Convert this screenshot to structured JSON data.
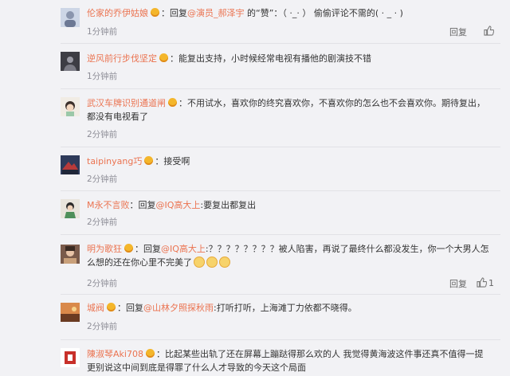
{
  "labels": {
    "reply": "回复"
  },
  "colors": {
    "name": "#eb7350",
    "time": "#8f8f98",
    "background": "#f2f2f5"
  },
  "comments": [
    {
      "name": "伦家的乔伊姑娘",
      "body_prefix": "：回复",
      "mention": "@演员_郝泽宇",
      "body": " 的“赞”：（  ·_· ）  偷偷评论不需的( · _ · )",
      "time": "1分钟前",
      "like_count": ""
    },
    {
      "name": "逆风前行步伐坚定",
      "body_prefix": "：能复出支持，小时候经常电视有播他的剧演技不错",
      "mention": "",
      "body": "",
      "time": "1分钟前",
      "like_count": ""
    },
    {
      "name": "武汉车牌识别通道闸",
      "body_prefix": "：不用试水，喜欢你的终究喜欢你，不喜欢你的怎么也不会喜欢你。期待复出，都没有电视看了",
      "mention": "",
      "body": "",
      "time": "2分钟前",
      "like_count": ""
    },
    {
      "name": "taipinyang巧",
      "body_prefix": "：接受啊",
      "mention": "",
      "body": "",
      "time": "2分钟前",
      "like_count": ""
    },
    {
      "name": "M永不言败",
      "body_prefix": "：回复",
      "mention": "@IQ高大上",
      "body": ":要复出都复出",
      "time": "2分钟前",
      "like_count": ""
    },
    {
      "name": "明为歌狂",
      "body_prefix": "：回复",
      "mention": "@IQ高大上",
      "body": ":？？？？？？？？被人陷害，再说了最终什么都没发生，你一个大男人怎么想的还在你心里不完美了",
      "time": "2分钟前",
      "like_count": "1"
    },
    {
      "name": "城阀",
      "body_prefix": "：回复",
      "mention": "@山林夕照探秋雨",
      "body": ":打听打听，上海滩丁力依都不晓得。",
      "time": "2分钟前",
      "like_count": ""
    },
    {
      "name": "陳淑琴Aki708",
      "body_prefix": "：比起某些出轨了还在屏幕上蹦跶得那么欢的人 我觉得黄海波这件事还真不值得一提 更别说这中间到底是得罪了什么人才导致的今天这个局面",
      "mention": "",
      "body": "",
      "time": "",
      "like_count": ""
    }
  ]
}
